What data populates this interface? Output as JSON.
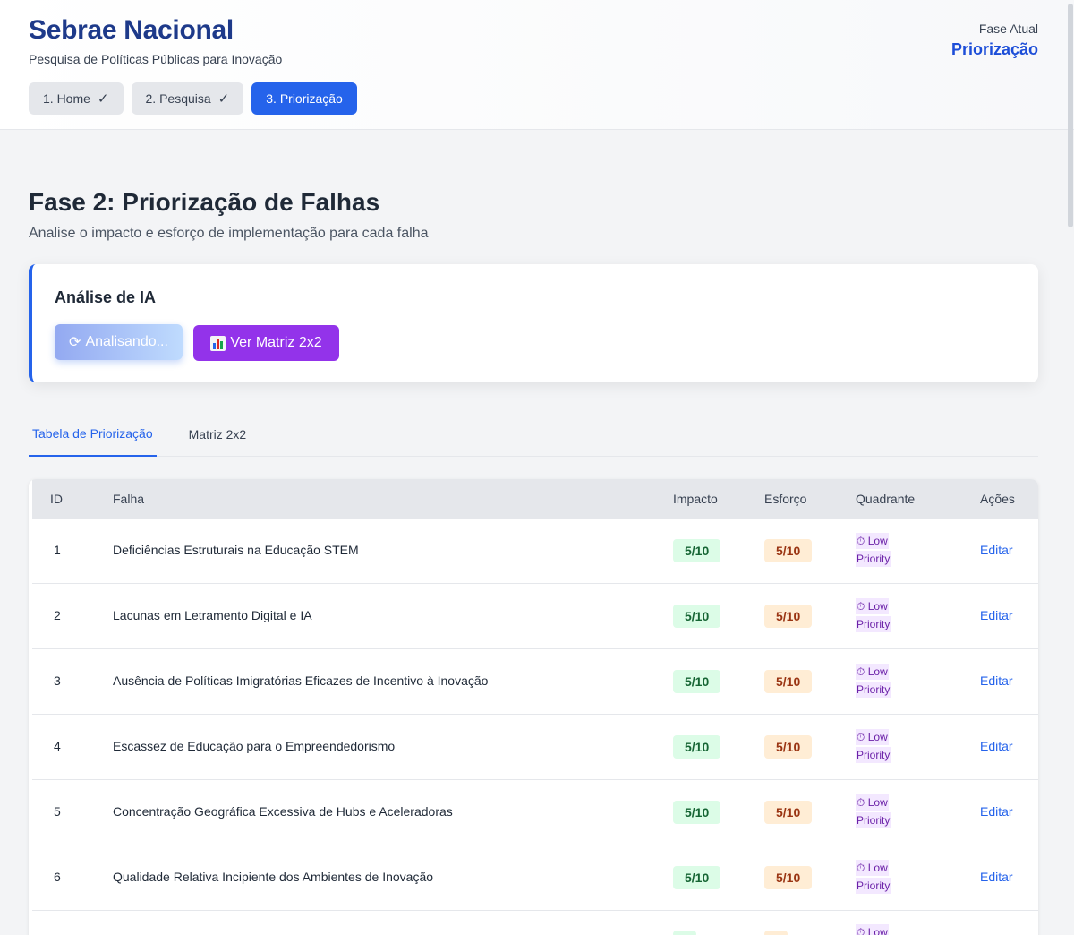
{
  "header": {
    "title": "Sebrae Nacional",
    "subtitle": "Pesquisa de Políticas Públicas para Inovação",
    "phase_label": "Fase Atual",
    "phase_value": "Priorização",
    "steps": [
      {
        "label": "1. Home",
        "check": "✓",
        "done": true
      },
      {
        "label": "2. Pesquisa",
        "check": "✓",
        "done": true
      },
      {
        "label": "3. Priorização",
        "check": "",
        "done": false
      }
    ]
  },
  "main": {
    "title": "Fase 2: Priorização de Falhas",
    "subtitle": "Analise o impacto e esforço de implementação para cada falha"
  },
  "ai_card": {
    "title": "Análise de IA",
    "analyzing_label": "Analisando...",
    "analyzing_icon": "⟳",
    "matrix_label": "Ver Matriz 2x2",
    "matrix_icon": "bar-chart-icon"
  },
  "tabs": [
    {
      "label": "Tabela de Priorização",
      "active": true
    },
    {
      "label": "Matriz 2x2",
      "active": false
    }
  ],
  "table": {
    "columns": [
      "ID",
      "Falha",
      "Impacto",
      "Esforço",
      "Quadrante",
      "Ações"
    ],
    "rows": [
      {
        "id": "1",
        "falha": "Deficiências Estruturais na Educação STEM",
        "impacto": "5/10",
        "esforco": "5/10",
        "quadrante_icon": "⏱",
        "quadrante_line1": "Low",
        "quadrante_line2": "Priority",
        "acao": "Editar"
      },
      {
        "id": "2",
        "falha": "Lacunas em Letramento Digital e IA",
        "impacto": "5/10",
        "esforco": "5/10",
        "quadrante_icon": "⏱",
        "quadrante_line1": "Low",
        "quadrante_line2": "Priority",
        "acao": "Editar"
      },
      {
        "id": "3",
        "falha": "Ausência de Políticas Imigratórias Eficazes de Incentivo à Inovação",
        "impacto": "5/10",
        "esforco": "5/10",
        "quadrante_icon": "⏱",
        "quadrante_line1": "Low",
        "quadrante_line2": "Priority",
        "acao": "Editar"
      },
      {
        "id": "4",
        "falha": "Escassez de Educação para o Empreendedorismo",
        "impacto": "5/10",
        "esforco": "5/10",
        "quadrante_icon": "⏱",
        "quadrante_line1": "Low",
        "quadrante_line2": "Priority",
        "acao": "Editar"
      },
      {
        "id": "5",
        "falha": "Concentração Geográfica Excessiva de Hubs e Aceleradoras",
        "impacto": "5/10",
        "esforco": "5/10",
        "quadrante_icon": "⏱",
        "quadrante_line1": "Low",
        "quadrante_line2": "Priority",
        "acao": "Editar"
      },
      {
        "id": "6",
        "falha": "Qualidade Relativa Incipiente dos Ambientes de Inovação",
        "impacto": "5/10",
        "esforco": "5/10",
        "quadrante_icon": "⏱",
        "quadrante_line1": "Low",
        "quadrante_line2": "Priority",
        "acao": "Editar"
      },
      {
        "id": "",
        "falha": "",
        "impacto": "",
        "esforco": "",
        "quadrante_icon": "⏱",
        "quadrante_line1": "Low",
        "quadrante_line2": "",
        "acao": ""
      }
    ]
  },
  "colors": {
    "brand": "#1e3a8a",
    "accent": "#2563eb",
    "matrix_button": "#9333ea",
    "impact_bg": "#dcfce7",
    "effort_bg": "#ffedd5",
    "quadrant_bg": "#f3e8ff"
  }
}
